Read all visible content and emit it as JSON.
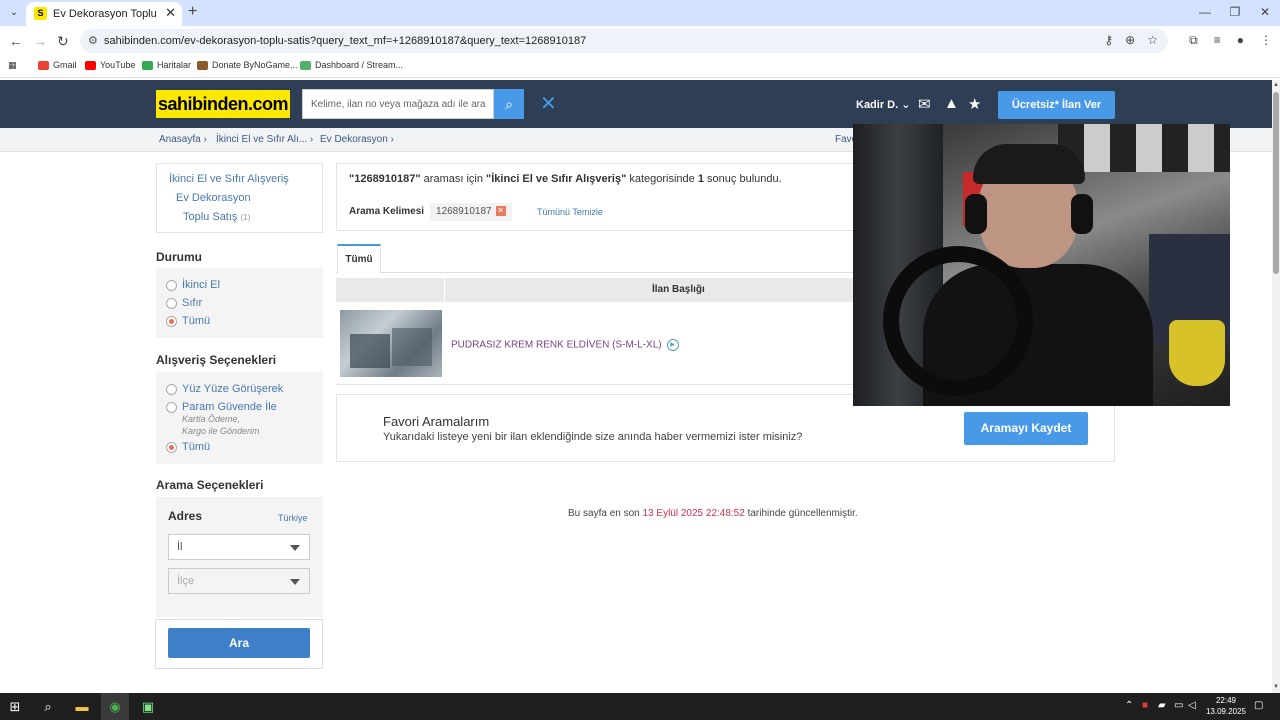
{
  "browser": {
    "tab_title": "Ev Dekorasyon Toplu Satış Ürün",
    "tab_favicon": "S",
    "url": "sahibinden.com/ev-dekorasyon-toplu-satis?query_text_mf=+1268910187&query_text=1268910187",
    "bookmarks": [
      "Gmail",
      "YouTube",
      "Haritalar",
      "Donate ByNoGame...",
      "Dashboard / Stream..."
    ]
  },
  "site": {
    "logo": "sahibinden.com",
    "search_placeholder": "Kelime, ilan no veya mağaza adı ile ara",
    "user": "Kadir D.",
    "post_button": "Ücretsiz* İlan Ver"
  },
  "breadcrumb": [
    "Anasayfa",
    "İkinci El ve Sıfır Alı...",
    "Ev Dekorasyon",
    "Favo"
  ],
  "categories": {
    "root": "İkinci El ve Sıfır Alışveriş",
    "child": "Ev Dekorasyon",
    "leaf": "Toplu Satış",
    "leaf_count": "(1)"
  },
  "filters": {
    "condition_title": "Durumu",
    "condition_options": [
      "İkinci El",
      "Sıfır",
      "Tümü"
    ],
    "shopping_title": "Alışveriş Seçenekleri",
    "shopping_options": [
      "Yüz Yüze Görüşerek",
      "Param Güvende İle",
      "Tümü"
    ],
    "shopping_sub1": "Kartla Ödeme,",
    "shopping_sub2": "Kargo ile Gönderim",
    "search_options_title": "Arama Seçenekleri",
    "address_title": "Adres",
    "address_country": "Türkiye",
    "city_select": "İl",
    "district_select": "İlçe",
    "search_button": "Ara"
  },
  "results": {
    "query_quoted": "\"1268910187\"",
    "text_for": "araması için",
    "category_quoted": "\"İkinci El ve Sıfır Alışveriş\"",
    "text_category": "kategorisinde",
    "count": "1",
    "text_found": "sonuç bulundu.",
    "keyword_label": "Arama Kelimesi",
    "keyword": "1268910187",
    "clear_all": "Tümünü Temizle",
    "tab_all": "Tümü",
    "column_title": "İlan Başlığı",
    "item_title": "PUDRASIZ KREM RENK ELDİVEN (S-M-L-XL)"
  },
  "favorites": {
    "title": "Favori Aramalarım",
    "text": "Yukarıdaki listeye yeni bir ilan eklendiğinde size anında haber vermemizi ister misiniz?",
    "button": "Aramayı Kaydet"
  },
  "updated": {
    "prefix": "Bu sayfa en son",
    "date": "13 Eylül 2025 22:48:52",
    "suffix": "tarihinde güncellenmiştir."
  },
  "taskbar": {
    "time": "22:49",
    "date": "13.09.2025"
  },
  "colors": {
    "header_bg": "#2d3e55",
    "logo_yellow": "#ffe800",
    "accent_blue": "#489ae9",
    "link_blue": "#4879ad",
    "date_red": "#d0334a"
  }
}
